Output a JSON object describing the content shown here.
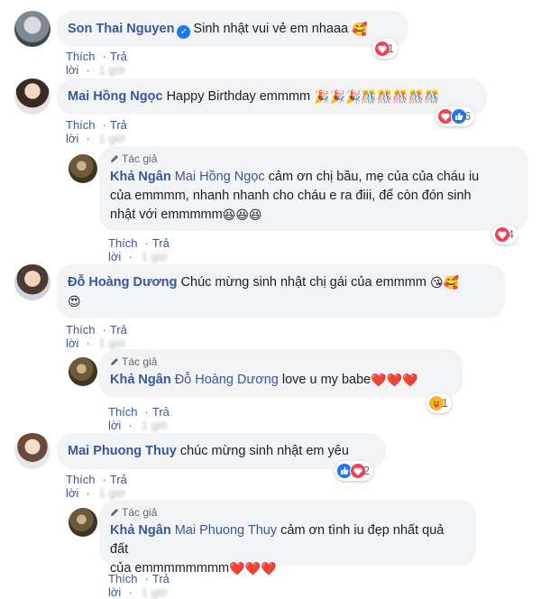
{
  "actions": {
    "like": "Thích",
    "reply": "Trả lời",
    "time_blurred": "1 giờ"
  },
  "author_badge": "Tác giả",
  "comments": [
    {
      "author": "Son Thai Nguyen",
      "verified": true,
      "text": "Sinh nhật vui vẻ em nhaaa",
      "emoji": "🥰",
      "reaction_count": "1",
      "reactions": [
        "love"
      ]
    },
    {
      "author": "Mai Hồng Ngọc",
      "text": "Happy Birthday emmmm",
      "emoji": "🎉🎉🎉🎊🎊🎊🎊🎊",
      "reaction_count": "6",
      "reactions": [
        "love",
        "like"
      ]
    },
    {
      "author": "Khả Ngân",
      "reply": true,
      "mention": "Mai Hồng Ngọc",
      "text_line1": "cảm ơn chị bầu, mẹ của của cháu iu",
      "text_line2": "của emmmm, nhanh nhanh cho cháu e ra điii, để còn đón sinh",
      "text_line3": "nhật với emmmmm",
      "emoji": "😆😆😆",
      "reaction_count": "4",
      "reactions": [
        "love"
      ]
    },
    {
      "author": "Đỗ Hoàng Dương",
      "text": "Chúc mừng sinh nhật chị gái của emmmm",
      "emoji": "😘🥰",
      "emoji_line2": "😍"
    },
    {
      "author": "Khả Ngân",
      "reply": true,
      "mention": "Đỗ Hoàng Dương",
      "text": "love u my babe",
      "emoji": "❤️❤️❤️",
      "reaction_count": "1",
      "reactions": [
        "care"
      ]
    },
    {
      "author": "Mai Phuong Thuy",
      "text": "chúc mừng sinh nhật em yêu",
      "reaction_count": "2",
      "reactions": [
        "like",
        "love"
      ]
    },
    {
      "author": "Khả Ngân",
      "reply": true,
      "mention": "Mai Phuong Thuy",
      "text_line1": "cảm ơn tình iu đẹp nhất quả đất",
      "text_line2": "của emmmmmmmm",
      "emoji": "❤️❤️❤️"
    }
  ],
  "colors": {
    "link": "#385898",
    "bubble": "#f2f3f5",
    "love": "#f33e58",
    "like": "#1877f2",
    "care": "#f7b125"
  }
}
